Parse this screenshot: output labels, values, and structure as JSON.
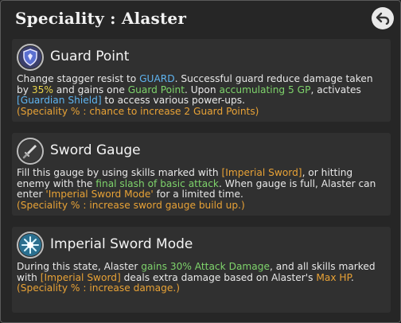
{
  "header": {
    "title": "Speciality : Alaster",
    "back_icon": "back-arrow-icon"
  },
  "sections": [
    {
      "icon": "shield-icon",
      "name": "Guard Point",
      "text": [
        "Change stagger resist to ",
        "GUARD",
        ". Successful guard reduce damage taken by ",
        "35%",
        " and gains one ",
        "Guard Point",
        ". Upon ",
        "accumulating 5 GP",
        ", activates ",
        "[Guardian Shield]",
        " to access various power-ups."
      ],
      "note": "(Speciality % : chance to increase 2 Guard Points)"
    },
    {
      "icon": "sword-icon",
      "name": "Sword Gauge",
      "text": [
        "Fill this gauge by using skills marked with ",
        "[Imperial Sword]",
        ", or hitting enemy with the ",
        "final slash of basic attack",
        ". When gauge is full, Alaster can enter ",
        "'Imperial Sword Mode'",
        " for a limited time."
      ],
      "note": "(Speciality % : increase sword gauge build up.)"
    },
    {
      "icon": "burst-icon",
      "name": "Imperial Sword Mode",
      "text": [
        "During this state, Alaster ",
        "gains 30% Attack Damage",
        ", and all skills marked with ",
        "[Imperial Sword]",
        " deals extra damage based on Alaster's ",
        "Max HP",
        "."
      ],
      "note": "(Speciality % : increase damage.)"
    }
  ],
  "colors": {
    "background": "#262626",
    "card": "#303030",
    "keyword_blue": "#5fb4f0",
    "keyword_yellow": "#e9d44a",
    "keyword_green": "#7ed36b",
    "note_orange": "#e8a236"
  }
}
